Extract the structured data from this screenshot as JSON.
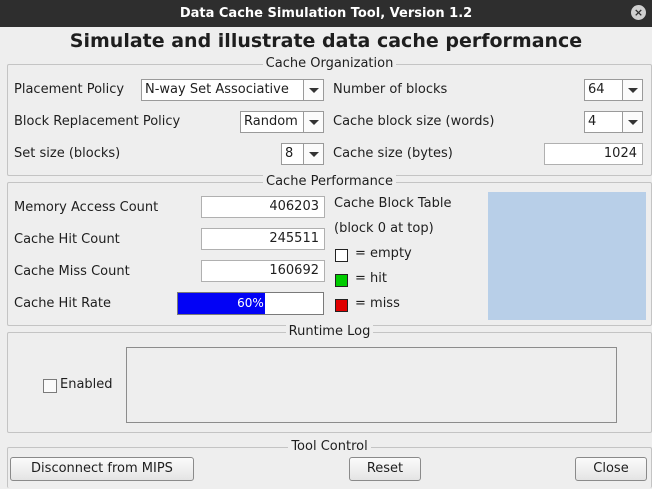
{
  "window": {
    "title": "Data Cache Simulation Tool, Version 1.2",
    "close_glyph": "×"
  },
  "heading": "Simulate and illustrate data cache performance",
  "organization": {
    "title": "Cache Organization",
    "placement_label": "Placement Policy",
    "placement_value": "N-way Set Associative",
    "replacement_label": "Block Replacement Policy",
    "replacement_value": "Random",
    "setsize_label": "Set size (blocks)",
    "setsize_value": "8",
    "numblocks_label": "Number of blocks",
    "numblocks_value": "64",
    "blocksize_label": "Cache block size (words)",
    "blocksize_value": "4",
    "cachesize_label": "Cache size (bytes)",
    "cachesize_value": "1024"
  },
  "performance": {
    "title": "Cache Performance",
    "access_label": "Memory Access Count",
    "access_value": "406203",
    "hit_label": "Cache Hit Count",
    "hit_value": "245511",
    "miss_label": "Cache Miss Count",
    "miss_value": "160692",
    "rate_label": "Cache Hit Rate",
    "rate_text": "60%",
    "rate_fraction": 0.6,
    "table_title": "Cache Block Table",
    "table_subtitle": "(block 0 at top)",
    "legend": {
      "empty": "= empty",
      "hit": "= hit",
      "miss": "= miss"
    },
    "colors": {
      "empty": "#ffffff",
      "hit": "#00cc00",
      "miss": "#e00000",
      "bar": "#0202f6",
      "table": "#b8cfe8"
    }
  },
  "log": {
    "title": "Runtime Log",
    "enabled_label": "Enabled",
    "enabled": false
  },
  "control": {
    "title": "Tool Control",
    "disconnect": "Disconnect from MIPS",
    "reset": "Reset",
    "close": "Close"
  }
}
